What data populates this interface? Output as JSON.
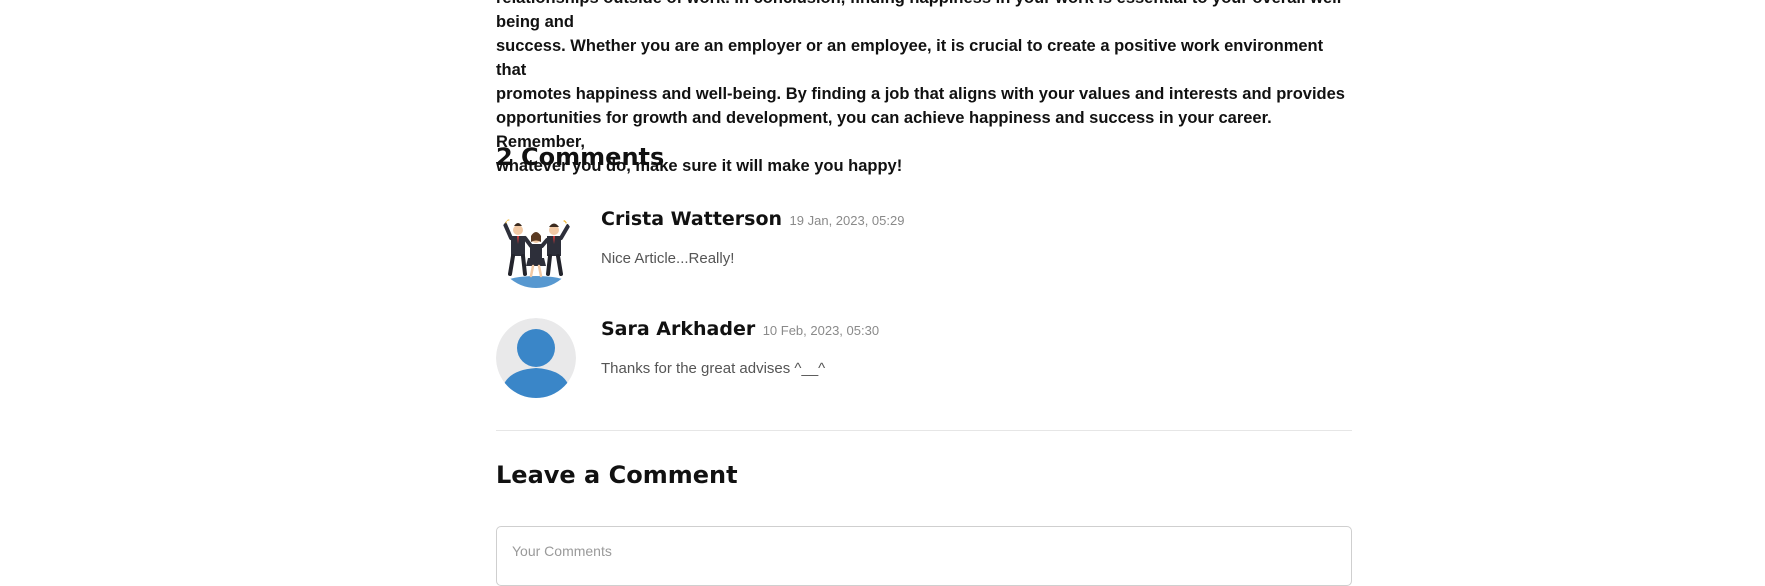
{
  "article": {
    "closing_text": "relationships outside of work. In conclusion, finding happiness in your work is essential to your overall well-being and\nsuccess. Whether you are an employer or an employee, it is crucial to create a positive work environment that\npromotes happiness and well-being. By finding a job that aligns with your values and interests and provides\nopportunities for growth and development, you can achieve happiness and success in your career. Remember,\nwhatever you do, make sure it will make you happy!"
  },
  "comments_section": {
    "heading": "2 Comments",
    "comments": [
      {
        "author": "Crista Watterson",
        "date": "19 Jan, 2023, 05:29",
        "text": "Nice Article...Really!",
        "avatar_icon": "cheering-business-team-illustration"
      },
      {
        "author": "Sara Arkhader",
        "date": "10 Feb, 2023, 05:30",
        "text": "Thanks for the great advises ^__^",
        "avatar_icon": "default-user-icon"
      }
    ]
  },
  "leave_comment": {
    "heading": "Leave a Comment",
    "placeholder": "Your Comments"
  },
  "colors": {
    "heading": "#111111",
    "muted_text": "#555555",
    "date_text": "#8a8a8a",
    "avatar_blue": "#3a86c8",
    "avatar_bg": "#e9e9ea",
    "divider": "#e6e6e6"
  }
}
